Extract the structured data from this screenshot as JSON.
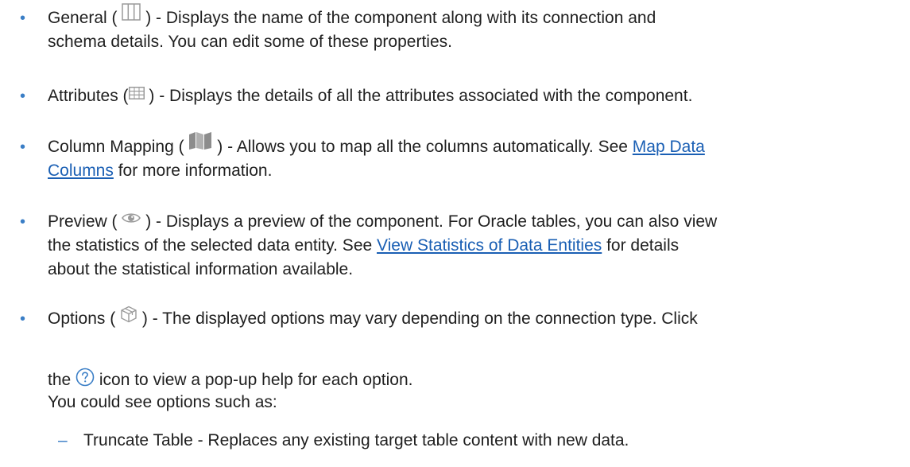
{
  "items": [
    {
      "label_pre": "General (",
      "icon": "columns-icon",
      "text": ") - Displays the name of the component along with its connection and",
      "text2": "schema details. You can edit some of these properties."
    },
    {
      "label_pre": "Attributes (",
      "icon": "grid-table-icon",
      "text": ") - Displays the details of all the attributes associated with the component."
    },
    {
      "label_pre": "Column Mapping (",
      "icon": "map-icon",
      "text": ") - Allows you to map all the columns automatically. See ",
      "link1": "Map Data",
      "link2": "Columns",
      "after": " for more information."
    },
    {
      "label_pre": "Preview (",
      "icon": "eye-icon",
      "text": ") - Displays a preview of the component. For Oracle tables, you can also view",
      "line2_pre": "the statistics of the selected data entity. See ",
      "link": "View Statistics of Data Entities",
      "line2_post": " for details",
      "line3": "about the statistical information available."
    },
    {
      "label_pre": "Options (",
      "icon": "cube-icon",
      "text": ") - The displayed options may vary depending on the connection type. Click",
      "help_pre": "the ",
      "help_icon": "help-icon",
      "help_post": " icon to view a pop-up help for each option.",
      "line3": "You could see options such as:"
    }
  ],
  "subitems": [
    {
      "text": "Truncate Table - Replaces any existing target table content with new data."
    }
  ],
  "colors": {
    "bullet": "#3a7ec6",
    "link": "#1a5fb4",
    "icon_gray": "#9a9a9a"
  }
}
